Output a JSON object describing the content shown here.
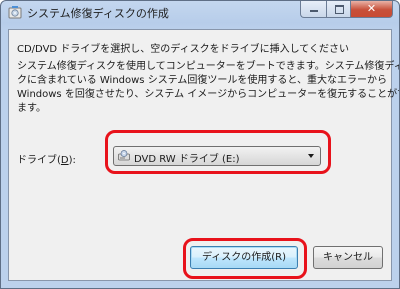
{
  "window": {
    "title": "システム修復ディスクの作成",
    "caption_buttons": {
      "close_glyph": "✕"
    }
  },
  "instruction": "CD/DVD ドライブを選択し、空のディスクをドライブに挿入してください",
  "description_lines": [
    "システム修復ディスクを使用してコンピューターをブートできます。システム修復ディス",
    "クに含まれている Windows システム回復ツールを使用すると、重大なエラーから",
    "Windows を回復させたり、システム イメージからコンピューターを復元することができ",
    "ます。"
  ],
  "drive": {
    "label_prefix": "ドライブ(",
    "label_key": "D",
    "label_suffix": "):",
    "selected": "DVD RW ドライブ (E:)",
    "icon": "optical-drive-icon"
  },
  "buttons": {
    "create": "ディスクの作成(R)",
    "cancel": "キャンセル"
  },
  "colors": {
    "highlight": "#e8121b",
    "window_frame": "#b7cdea",
    "client_bg": "#f0f0f0"
  }
}
